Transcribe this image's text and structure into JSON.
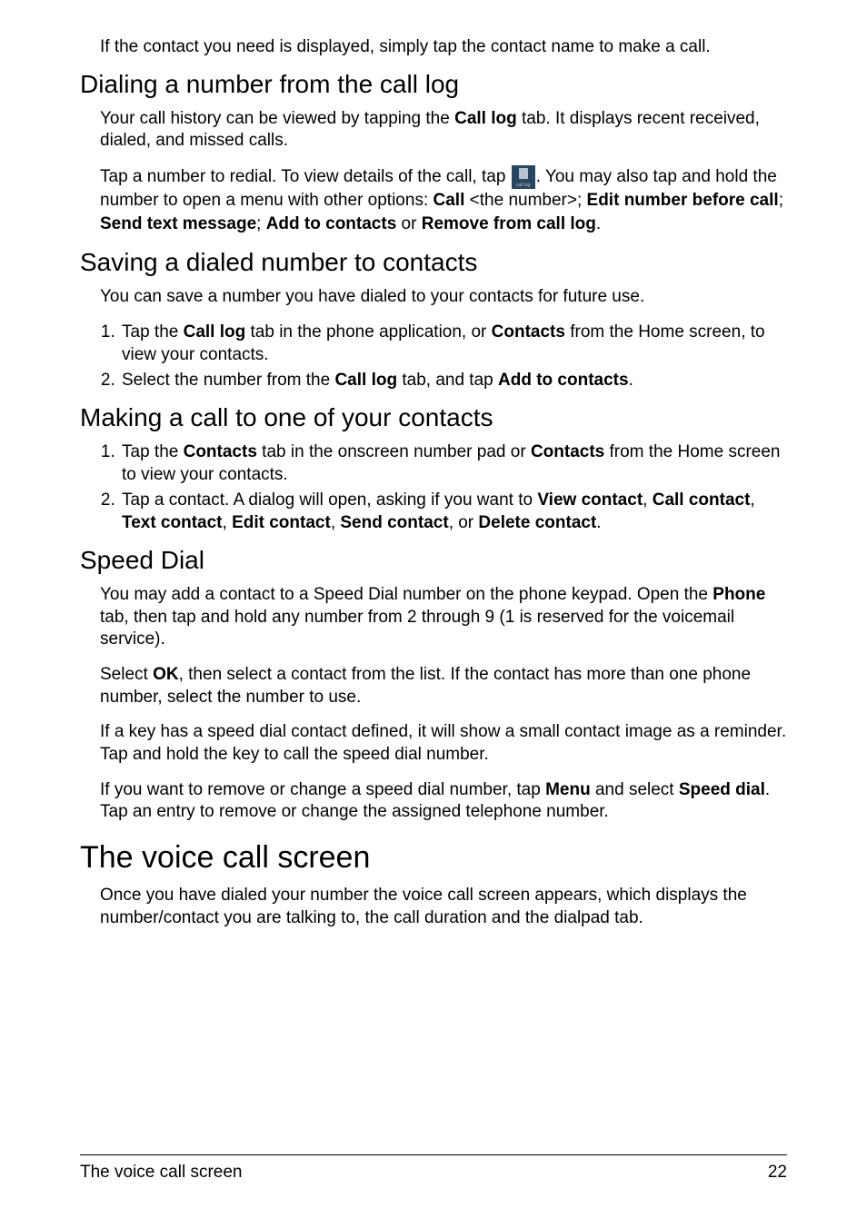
{
  "intro": "If the contact you need is displayed, simply tap the contact name to make a call.",
  "sections": {
    "dialing": {
      "heading": "Dialing a number from the call log",
      "p1_a": "Your call history can be viewed by tapping the ",
      "p1_b": "Call log",
      "p1_c": " tab. It displays recent received, dialed, and missed calls.",
      "p2_a": "Tap a number to redial. To view details of the call, tap ",
      "p2_b": ". You may also tap and hold the number to open a menu with other options: ",
      "p2_c": "Call",
      "p2_d": " <the number>; ",
      "p2_e": "Edit number before call",
      "p2_f": "; ",
      "p2_g": "Send text message",
      "p2_h": "; ",
      "p2_i": "Add to contacts",
      "p2_j": " or ",
      "p2_k": "Remove from call log",
      "p2_l": "."
    },
    "saving": {
      "heading": "Saving a dialed number to contacts",
      "p1": "You can save a number you have dialed to your contacts for future use.",
      "li1_a": "Tap the ",
      "li1_b": "Call log",
      "li1_c": " tab in the phone application, or ",
      "li1_d": "Contacts",
      "li1_e": " from the Home screen, to view your contacts.",
      "li2_a": "Select the number from the ",
      "li2_b": "Call log",
      "li2_c": " tab, and tap ",
      "li2_d": "Add to contacts",
      "li2_e": "."
    },
    "making": {
      "heading": "Making a call to one of your contacts",
      "li1_a": "Tap the ",
      "li1_b": "Contacts",
      "li1_c": " tab in the onscreen number pad or ",
      "li1_d": "Contacts",
      "li1_e": " from the Home screen to view your contacts.",
      "li2_a": "Tap a contact. A dialog will open, asking if you want to ",
      "li2_b": "View contact",
      "li2_c": ", ",
      "li2_d": "Call contact",
      "li2_e": ", ",
      "li2_f": "Text contact",
      "li2_g": ", ",
      "li2_h": "Edit contact",
      "li2_i": ", ",
      "li2_j": "Send contact",
      "li2_k": ", or ",
      "li2_l": "Delete contact",
      "li2_m": "."
    },
    "speed": {
      "heading": "Speed Dial",
      "p1_a": "You may add a contact to a Speed Dial number on the phone keypad. Open the ",
      "p1_b": "Phone",
      "p1_c": " tab, then tap and hold any number from 2 through 9 (1 is reserved for the voicemail service).",
      "p2_a": "Select ",
      "p2_b": "OK",
      "p2_c": ", then select a contact from the list. If the contact has more than one phone number, select the number to use.",
      "p3": "If a key has a speed dial contact defined, it will show a small contact image as a reminder. Tap and hold the key to call the speed dial number.",
      "p4_a": "If you want to remove or change a speed dial number, tap ",
      "p4_b": "Menu",
      "p4_c": " and select ",
      "p4_d": "Speed dial",
      "p4_e": ". Tap an entry to remove or change the assigned telephone number."
    },
    "voice": {
      "heading": "The voice call screen",
      "p1": "Once you have dialed your number the voice call screen appears, which displays the number/contact you are talking to, the call duration and the dialpad tab."
    }
  },
  "footer": {
    "title": "The voice call screen",
    "page": "22"
  }
}
